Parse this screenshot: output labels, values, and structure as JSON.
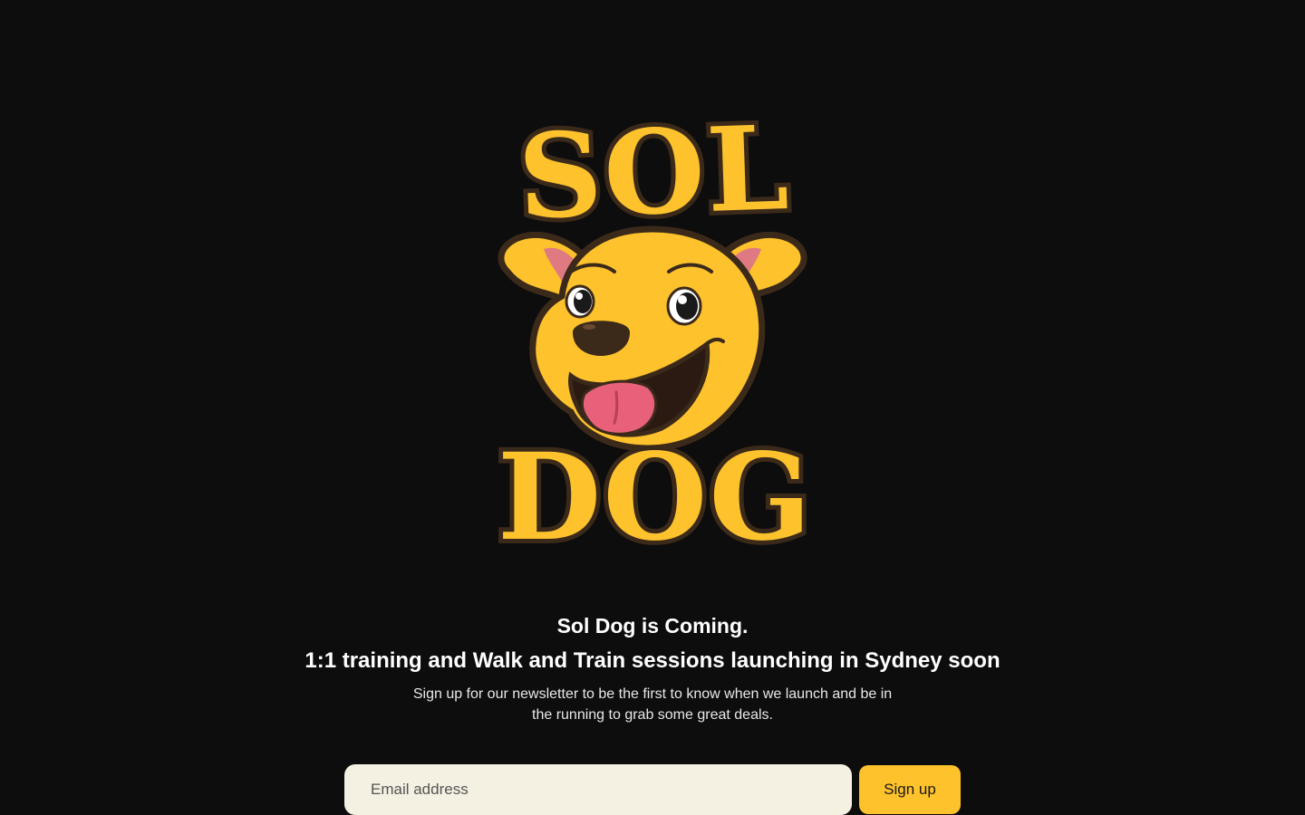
{
  "brand": {
    "logo_text_top": "SOL",
    "logo_text_bottom": "DOG",
    "colors": {
      "background": "#0d0d0d",
      "brand_yellow": "#fdc22c",
      "outline_brown": "#3b2a1a",
      "tongue_pink": "#e8607a",
      "input_bg": "#f4f0e2"
    }
  },
  "hero": {
    "headline": "Sol Dog is Coming.",
    "subheadline": "1:1 training and Walk and Train sessions launching in Sydney soon",
    "description": "Sign up for our newsletter to be the first to know when we launch and be in the running to grab some great deals."
  },
  "newsletter": {
    "email_placeholder": "Email address",
    "email_value": "",
    "submit_label": "Sign up"
  }
}
